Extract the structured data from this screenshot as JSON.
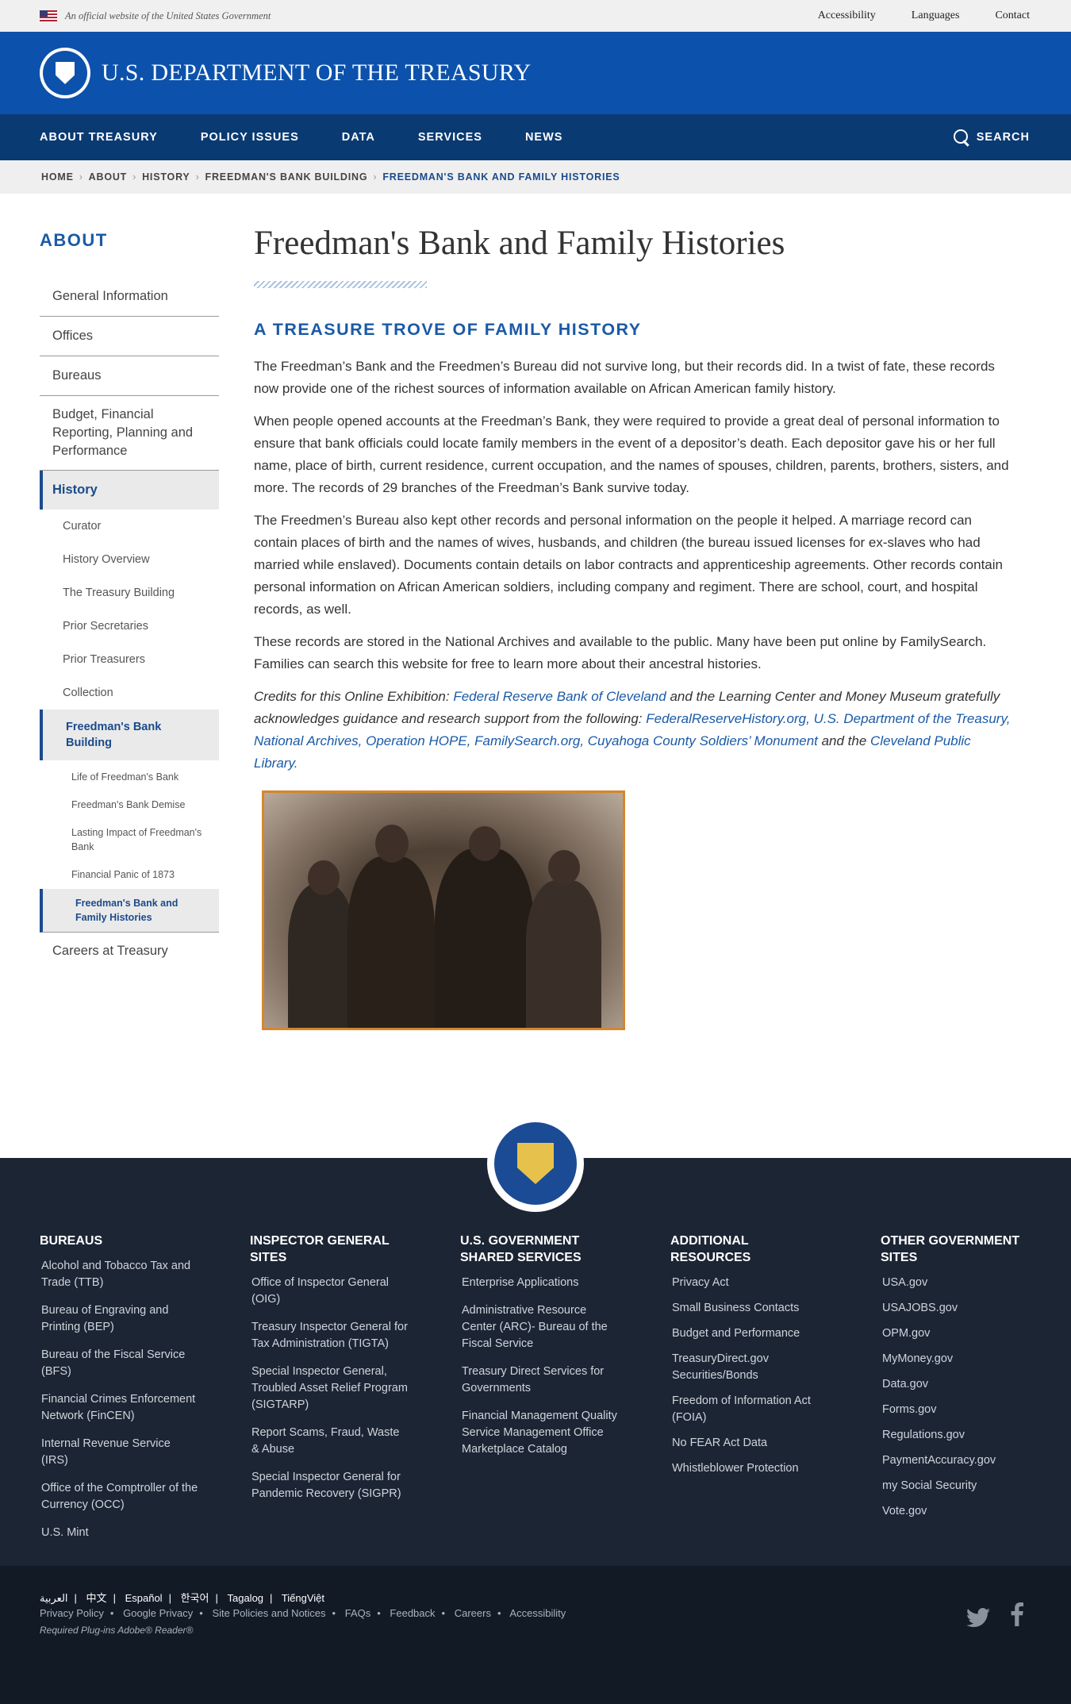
{
  "gov_banner": {
    "official_text": "An official website of the United States Government",
    "links": [
      "Accessibility",
      "Languages",
      "Contact"
    ]
  },
  "header": {
    "title": "U.S. DEPARTMENT OF THE TREASURY"
  },
  "nav": {
    "items": [
      "ABOUT TREASURY",
      "POLICY ISSUES",
      "DATA",
      "SERVICES",
      "NEWS"
    ],
    "search_label": "SEARCH"
  },
  "breadcrumb": [
    "HOME",
    "ABOUT",
    "HISTORY",
    "FREEDMAN'S BANK BUILDING",
    "FREEDMAN'S BANK AND FAMILY HISTORIES"
  ],
  "sidebar": {
    "heading": "ABOUT",
    "items": [
      "General Information",
      "Offices",
      "Bureaus",
      "Budget, Financial Reporting, Planning and Performance",
      "History"
    ],
    "history_sub": [
      "Curator",
      "History Overview",
      "The Treasury Building",
      "Prior Secretaries",
      "Prior Treasurers",
      "Collection",
      "Freedman's Bank Building"
    ],
    "building_sub": [
      "Life of Freedman's Bank",
      "Freedman's Bank Demise",
      "Lasting Impact of Freedman's Bank",
      "Financial Panic of 1873",
      "Freedman's Bank and Family Histories"
    ],
    "last_item": "Careers at Treasury"
  },
  "main": {
    "title": "Freedman's Bank and Family Histories",
    "subtitle": "A TREASURE TROVE OF FAMILY HISTORY",
    "paragraphs": [
      "The Freedman’s Bank and the Freedmen’s Bureau did not survive long, but their records did. In a twist of fate, these records now provide one of the richest sources of information available on African American family history.",
      "When people opened accounts at the Freedman’s Bank, they were required to provide a great deal of personal information to ensure that bank officials could locate family members in the event of a depositor’s death. Each depositor gave his or her full name, place of birth, current residence, current occupation, and the names of spouses, children, parents, brothers, sisters, and more. The records of 29 branches of the Freedman’s Bank survive today.",
      "The Freedmen’s Bureau also kept other records and personal information on the people it helped. A marriage record can contain places of birth and the names of wives, husbands, and children (the bureau issued licenses for ex-slaves who had married while enslaved). Documents contain details on labor contracts and apprenticeship agreements. Other records contain personal information on African American soldiers, including company and regiment. There are school, court, and hospital records, as well.",
      "These records are stored in the National Archives and available to the public. Many have been put online by FamilySearch. Families can search this website for free to learn more about their ancestral histories."
    ],
    "credits": {
      "lead": "Credits for this Online Exhibition: ",
      "link1": "Federal Reserve Bank of Cleveland",
      "middle": " and the Learning Center and Money Museum gratefully acknowledges guidance and research support from the following: ",
      "link2": "FederalReserveHistory.org, U.S. Department of the Treasury, National Archives, Operation HOPE, FamilySearch.org, Cuyahoga County Soldiers’ Monument",
      "and_the": " and the ",
      "link3": "Cleveland Public Library."
    }
  },
  "footer": {
    "columns": [
      {
        "heading": "BUREAUS",
        "links": [
          "Alcohol and Tobacco Tax and Trade (TTB)",
          "Bureau of Engraving and Printing (BEP)",
          "Bureau of the Fiscal Service (BFS)",
          "Financial Crimes Enforcement Network (FinCEN)",
          "Internal Revenue Service (IRS)",
          "Office of the Comptroller of the Currency (OCC)",
          "U.S. Mint"
        ]
      },
      {
        "heading": "INSPECTOR GENERAL SITES",
        "links": [
          "Office of Inspector General (OIG)",
          "Treasury Inspector General for Tax Administration (TIGTA)",
          "Special Inspector General, Troubled Asset Relief Program (SIGTARP)",
          "Report Scams, Fraud, Waste & Abuse",
          "Special Inspector General for Pandemic Recovery (SIGPR)"
        ]
      },
      {
        "heading": "U.S. GOVERNMENT SHARED SERVICES",
        "links": [
          "Enterprise Applications",
          "Administrative Resource Center (ARC)- Bureau of the Fiscal Service",
          "Treasury Direct Services for Governments",
          "Financial Management Quality Service Management Office Marketplace Catalog"
        ]
      },
      {
        "heading": "ADDITIONAL RESOURCES",
        "links": [
          "Privacy Act",
          "Small Business Contacts",
          "Budget and Performance",
          "TreasuryDirect.gov Securities/Bonds",
          "Freedom of Information Act (FOIA)",
          "No FEAR Act Data",
          "Whistleblower Protection"
        ]
      },
      {
        "heading": "OTHER GOVERNMENT SITES",
        "links": [
          "USA.gov",
          "USAJOBS.gov",
          "OPM.gov",
          "MyMoney.gov",
          "Data.gov",
          "Forms.gov",
          "Regulations.gov",
          "PaymentAccuracy.gov",
          "my Social Security",
          "Vote.gov"
        ]
      }
    ],
    "languages": [
      "العربية",
      "中文",
      "Español",
      "한국어",
      "Tagalog",
      "TiếngViệt"
    ],
    "bottom_links": [
      "Privacy Policy",
      "Google Privacy",
      "Site Policies and Notices",
      "FAQs",
      "Feedback",
      "Careers",
      "Accessibility"
    ],
    "plugins": "Required Plug-ins  Adobe® Reader®"
  }
}
